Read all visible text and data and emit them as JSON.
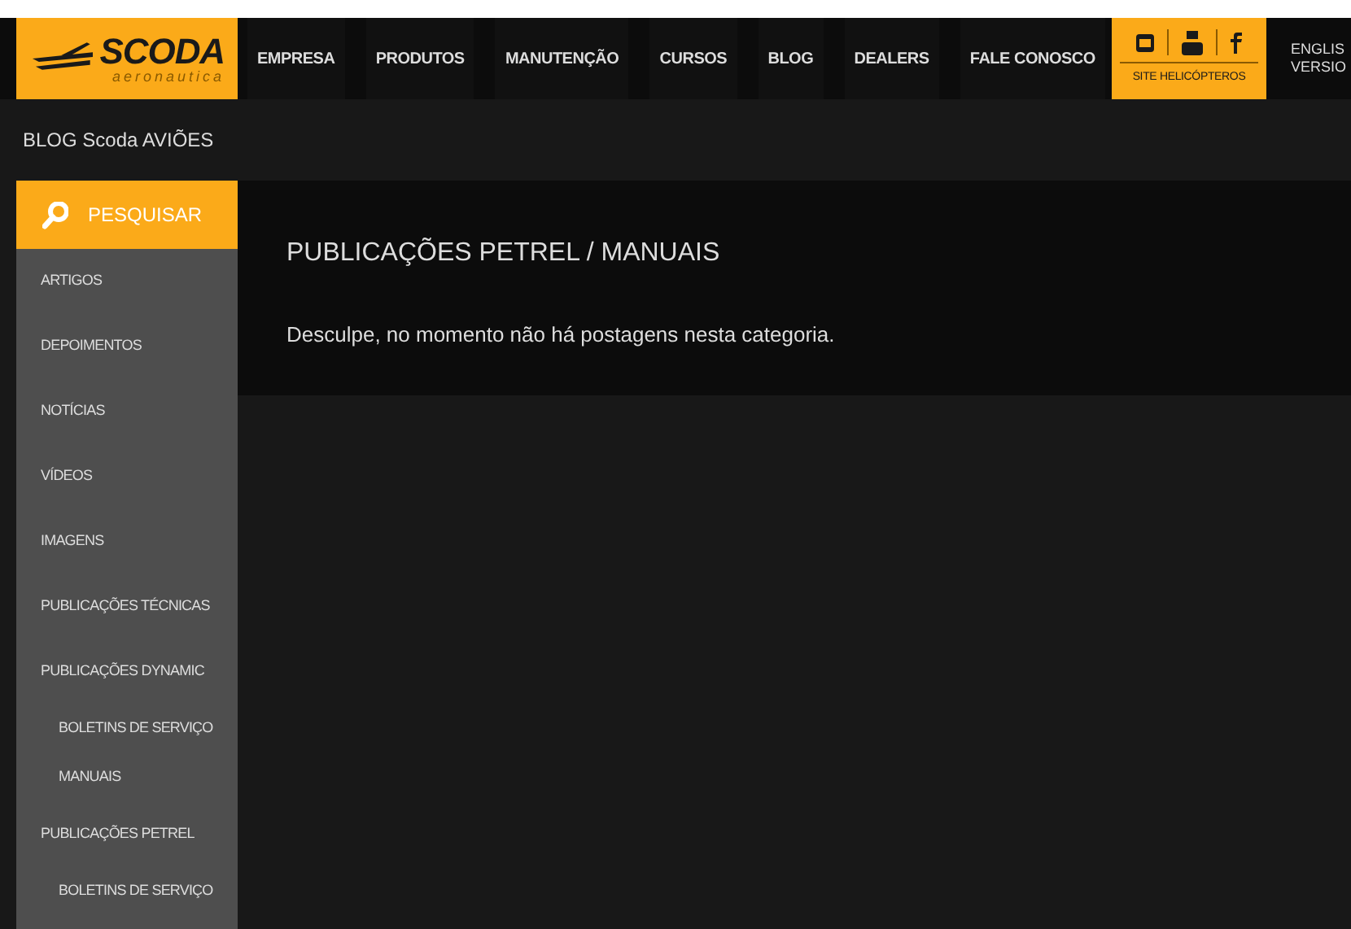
{
  "logo": {
    "name": "SCODA",
    "tagline": "aeronautica"
  },
  "nav": [
    {
      "label": "EMPRESA"
    },
    {
      "label": "PRODUTOS"
    },
    {
      "label": "MANUTENÇÃO"
    },
    {
      "label": "CURSOS"
    },
    {
      "label": "BLOG"
    },
    {
      "label": "DEALERS"
    },
    {
      "label": "FALE CONOSCO"
    }
  ],
  "social": {
    "link": "SITE HELICÓPTEROS"
  },
  "language": [
    "ENGLIS",
    "VERSIO"
  ],
  "breadcrumb": "BLOG Scoda AVIÕES",
  "sidebar": {
    "search": "PESQUISAR",
    "items": [
      {
        "label": "ARTIGOS"
      },
      {
        "label": "DEPOIMENTOS"
      },
      {
        "label": "NOTÍCIAS"
      },
      {
        "label": "VÍDEOS"
      },
      {
        "label": "IMAGENS"
      },
      {
        "label": "PUBLICAÇÕES TÉCNICAS"
      },
      {
        "label": "PUBLICAÇÕES DYNAMIC",
        "children": [
          {
            "label": "BOLETINS DE SERVIÇO"
          },
          {
            "label": "MANUAIS"
          }
        ]
      },
      {
        "label": "PUBLICAÇÕES PETREL",
        "children": [
          {
            "label": "BOLETINS DE SERVIÇO"
          }
        ]
      }
    ]
  },
  "content": {
    "title": "PUBLICAÇÕES PETREL / MANUAIS",
    "message": "Desculpe, no momento não há postagens nesta categoria."
  }
}
